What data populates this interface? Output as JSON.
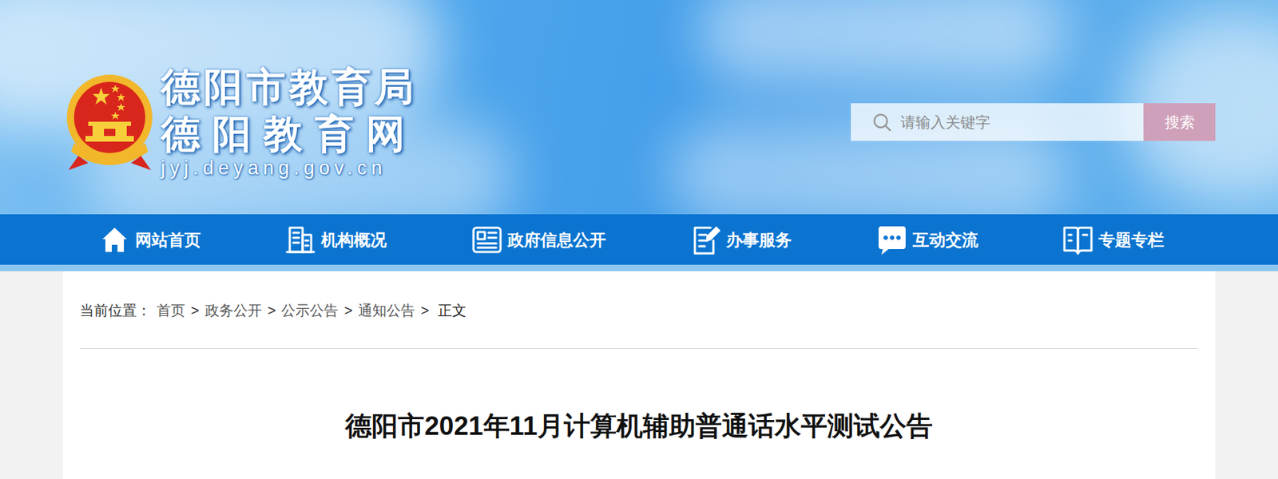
{
  "site": {
    "org_name": "德阳市教育局",
    "site_name": "德阳教育网",
    "domain": "jyj.deyang.gov.cn"
  },
  "search": {
    "placeholder": "请输入关键字",
    "button": "搜索"
  },
  "nav": [
    {
      "label": "网站首页",
      "kind": "home"
    },
    {
      "label": "机构概况",
      "kind": "org"
    },
    {
      "label": "政府信息公开",
      "kind": "info"
    },
    {
      "label": "办事服务",
      "kind": "service"
    },
    {
      "label": "互动交流",
      "kind": "chat"
    },
    {
      "label": "专题专栏",
      "kind": "topic"
    }
  ],
  "breadcrumb": {
    "label": "当前位置：",
    "separator": ">",
    "items": [
      "首页",
      "政务公开",
      "公示公告",
      "通知公告",
      "正文"
    ]
  },
  "article": {
    "title": "德阳市2021年11月计算机辅助普通话水平测试公告"
  }
}
